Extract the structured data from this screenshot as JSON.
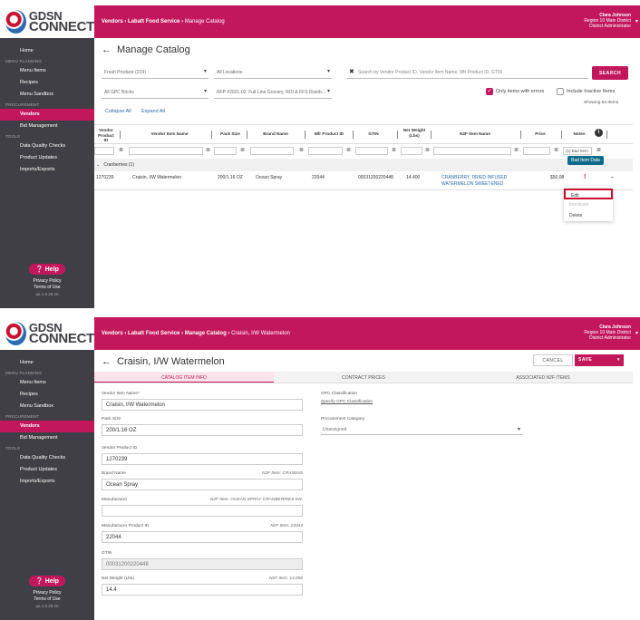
{
  "brand": {
    "line1": "GDSN",
    "line2": "CONNECT"
  },
  "nav": {
    "home": "Home",
    "menu_planning": "MENU PLANNING",
    "menu_items": "Menu Items",
    "recipes": "Recipes",
    "menu_sandbox": "Menu Sandbox",
    "procurement": "PROCUREMENT",
    "vendors": "Vendors",
    "bid_management": "Bid Management",
    "tools": "TOOLS",
    "data_quality": "Data Quality Checks",
    "product_updates": "Product Updates",
    "imports_exports": "Imports/Exports",
    "help": "Help",
    "privacy": "Privacy Policy",
    "terms": "Terms of Use",
    "version": "qa 1.0.28.20"
  },
  "user": {
    "name": "Clara Johnson",
    "region": "Region 10 Main District",
    "role": "District Administrator"
  },
  "panel1": {
    "crumbs": {
      "a": "Vendors",
      "b": "Labatt Food Service",
      "c": "Manage Catalog"
    },
    "title": "Manage Catalog",
    "filter1": "Fresh Produce (219)",
    "filter2": "All Locations",
    "search_placeholder": "Search by Vendor Product ID, Vendor Item Name, Mfr Product ID, GTIN",
    "search_btn": "SEARCH",
    "filter3": "All GPC Bricks",
    "filter4": "RFP #2021-02: Full-Line Grocery, NOI & FFS Distrib...",
    "only_errors": "Only items with errors",
    "inactive": "Include Inactive Items",
    "showing": "Showing 64 Items",
    "collapse": "Collapse All",
    "expand": "Expand All",
    "columns": {
      "vendor_pid": "Vendor Product ID",
      "vendor_name": "Vendor Item Name",
      "pack": "Pack Size",
      "brand": "Brand Name",
      "mfr": "Mfr Product ID",
      "gtin": "GTIN",
      "weight": "Net Weight (Lbs)",
      "n2f": "N2F Item Name",
      "price": "Price",
      "notes": "Notes"
    },
    "notes_filter": "(1) Bad Item",
    "group": "Cranberries (1)",
    "row": {
      "pid": "1270239",
      "name": "Craisin, I/W Watermelon",
      "pack": "200/1.16 OZ",
      "brand": "Ocean Spray",
      "mfr": "22044",
      "gtin": "00031200220448",
      "weight": "14.400",
      "n2f1": "CRANBERRY, DRIED INFUSED",
      "n2f2": "WATERMELON SWEETENED",
      "price": "$50.08",
      "flag": "!"
    },
    "tooltip": "Bad Item Data",
    "menu": {
      "edit": "Edit",
      "inactivate": "Inactivate",
      "delete": "Delete"
    }
  },
  "panel2": {
    "crumbs": {
      "a": "Vendors",
      "b": "Labatt Food Service",
      "c": "Manage Catalog",
      "d": "Craisin, I/W Watermelon"
    },
    "title": "Craisin, I/W Watermelon",
    "cancel": "CANCEL",
    "save": "SAVE",
    "tabs": {
      "info": "CATALOG ITEM INFO",
      "contract": "CONTRACT PRICES",
      "assoc": "ASSOCIATED N2F ITEMS"
    },
    "fields": {
      "vname_label": "Vendor Item Name*",
      "vname": "Craisin, I/W Watermelon",
      "pack_label": "Pack Size",
      "pack": "200/1.16 OZ",
      "vpid_label": "Vendor Product ID",
      "vpid": "1270239",
      "brand_label": "Brand Name",
      "brand_hint": "N2F Item: CRAISINS",
      "brand": "Ocean Spray",
      "mfr_label": "Manufacturer",
      "mfr_hint": "N2F Item: OCEAN SPRAY CRANBERRIES INC",
      "mpid_label": "Manufacturer Product ID",
      "mpid_hint": "N2F Item: 22044",
      "mpid": "22044",
      "gtin_label": "GTIN",
      "gtin": "00031200220448",
      "nw_label": "Net Weight (Lbs)",
      "nw_hint": "N2F Item: 14.000",
      "nw": "14.4"
    },
    "gpc_label": "GPC Classification",
    "gpc_link": "Specify GPC Classification",
    "proc_label": "Procurement Category",
    "proc_value": "Unassigned"
  },
  "colors": {
    "accent": "#c2185b",
    "sidebar": "#3f3f45",
    "link": "#2b6cb0"
  }
}
